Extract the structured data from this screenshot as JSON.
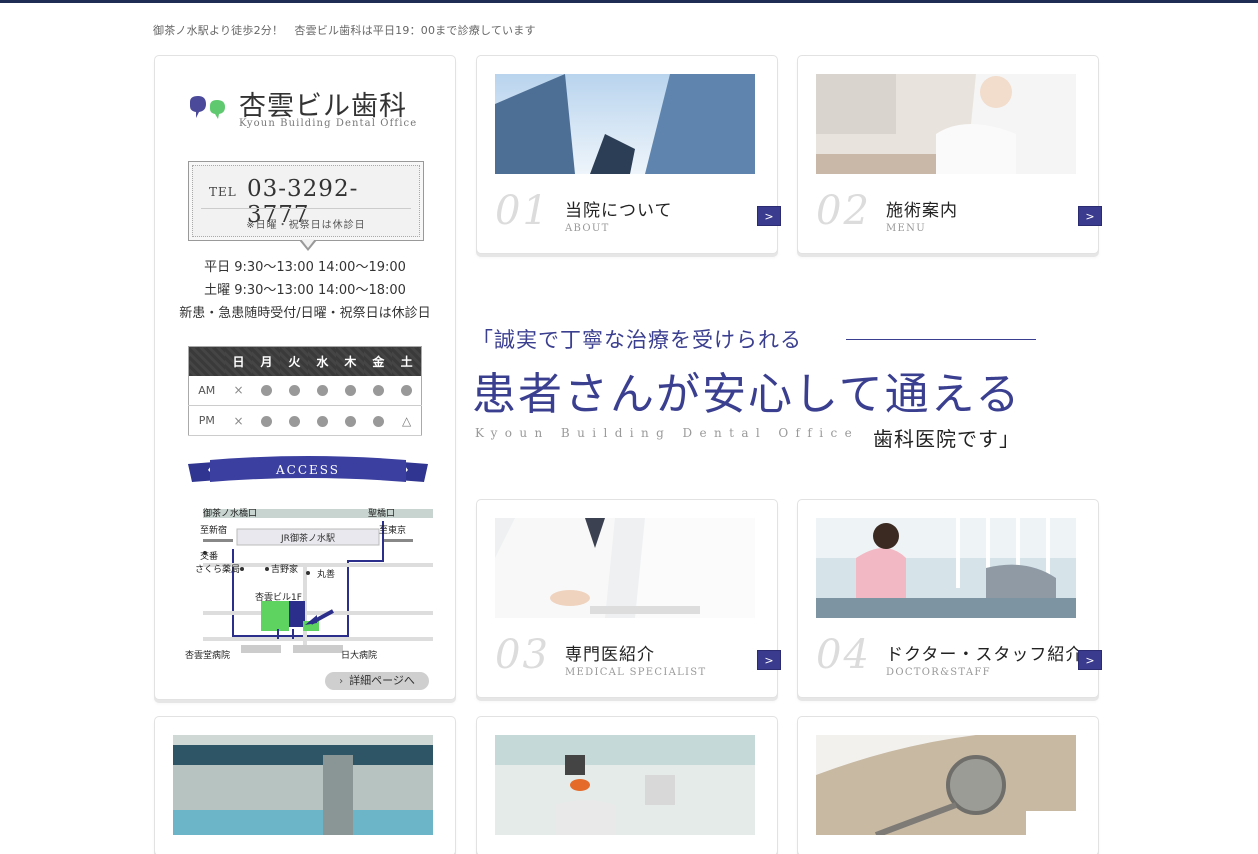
{
  "header": {
    "tagline": "御茶ノ水駅より徒歩2分！　杏雲ビル歯科は平日19：00まで診療しています"
  },
  "sidebar": {
    "logo_name": "杏雲ビル歯科",
    "logo_en": "Kyoun Building Dental Office",
    "tel_label": "TEL",
    "tel_number": "03-3292-3777",
    "tel_note": "※日曜・祝祭日は休診日",
    "hours": [
      "平日  9:30〜13:00  14:00〜19:00",
      "土曜  9:30〜13:00  14:00〜18:00",
      "新患・急患随時受付/日曜・祝祭日は休診日"
    ],
    "schedule": {
      "days": [
        "日",
        "月",
        "火",
        "水",
        "木",
        "金",
        "土"
      ],
      "rows": [
        {
          "label": "AM",
          "marks": [
            "×",
            "●",
            "●",
            "●",
            "●",
            "●",
            "●"
          ]
        },
        {
          "label": "PM",
          "marks": [
            "×",
            "●",
            "●",
            "●",
            "●",
            "●",
            "△"
          ]
        }
      ]
    },
    "access_title": "ACCESS",
    "map_labels": {
      "ochanomizu_bashi": "御茶ノ水橋口",
      "hijiri_bashi": "聖橋口",
      "to_shinjuku": "至新宿",
      "to_tokyo": "至東京",
      "station": "JR御茶ノ水駅",
      "koban": "交番",
      "sakura": "さくら薬局",
      "yoshinoya": "吉野家",
      "maruzen": "丸善",
      "building": "杏雲ビル1F",
      "kyoundo": "杏雲堂病院",
      "nichidai": "日大病院"
    },
    "detail_button": "詳細ページへ"
  },
  "menu": [
    {
      "num": "01",
      "title": "当院について",
      "sub": "ABOUT"
    },
    {
      "num": "02",
      "title": "施術案内",
      "sub": "MENU"
    },
    {
      "num": "03",
      "title": "専門医紹介",
      "sub": "MEDICAL SPECIALIST"
    },
    {
      "num": "04",
      "title": "ドクター・スタッフ紹介",
      "sub": "DOCTOR&STAFF"
    }
  ],
  "catch": {
    "line1": "「誠実で丁寧な治療を受けられる",
    "line2": "患者さんが安心して通える",
    "en": "Kyoun Building Dental Office",
    "line3": "歯科医院です」"
  },
  "colors": {
    "brand_navy": "#3b3f8f",
    "top_bar": "#1f2d55",
    "logo_green": "#5fc96f",
    "map_green": "#5fd35f"
  }
}
